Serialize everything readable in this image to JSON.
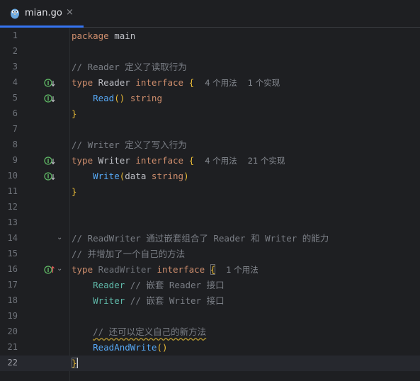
{
  "tab": {
    "title": "mian.go",
    "close": "×"
  },
  "lines": [
    {
      "n": "1"
    },
    {
      "n": "2"
    },
    {
      "n": "3"
    },
    {
      "n": "4"
    },
    {
      "n": "5"
    },
    {
      "n": "6"
    },
    {
      "n": "7"
    },
    {
      "n": "8"
    },
    {
      "n": "9"
    },
    {
      "n": "10"
    },
    {
      "n": "11"
    },
    {
      "n": "12"
    },
    {
      "n": "13"
    },
    {
      "n": "14"
    },
    {
      "n": "15"
    },
    {
      "n": "16"
    },
    {
      "n": "17"
    },
    {
      "n": "18"
    },
    {
      "n": "19"
    },
    {
      "n": "20"
    },
    {
      "n": "21"
    },
    {
      "n": "22"
    }
  ],
  "code": {
    "l1": {
      "kw": "package",
      "name": "main"
    },
    "l3": {
      "comment": "// Reader 定义了读取行为"
    },
    "l4": {
      "kw": "type",
      "name": "Reader",
      "kw2": "interface",
      "brace": "{",
      "hint1": "4 个用法",
      "hint2": "1 个实现"
    },
    "l5": {
      "fn": "Read",
      "parens": "()",
      "type": "string"
    },
    "l6": {
      "brace": "}"
    },
    "l8": {
      "comment": "// Writer 定义了写入行为"
    },
    "l9": {
      "kw": "type",
      "name": "Writer",
      "kw2": "interface",
      "brace": "{",
      "hint1": "4 个用法",
      "hint2": "21 个实现"
    },
    "l10": {
      "fn": "Write",
      "open": "(",
      "param": "data",
      "type": "string",
      "close": ")"
    },
    "l11": {
      "brace": "}"
    },
    "l14": {
      "comment": "// ReadWriter 通过嵌套组合了 Reader 和 Writer 的能力"
    },
    "l15": {
      "comment": "// 并增加了一个自己的方法"
    },
    "l16": {
      "kw": "type",
      "name": "ReadWriter",
      "kw2": "interface",
      "brace": "{",
      "hint1": "1 个用法"
    },
    "l17": {
      "embed": "Reader",
      "comment": "// 嵌套 Reader 接口"
    },
    "l18": {
      "embed": "Writer",
      "comment": "// 嵌套 Writer 接口"
    },
    "l20": {
      "comment": "// 还可以定义自己的新方法"
    },
    "l21": {
      "fn": "ReadAndWrite",
      "parens": "()"
    },
    "l22": {
      "brace": "}"
    }
  },
  "icons": {
    "tab_icon": "gopher-icon",
    "impl_down": "implemented-down-icon",
    "impl_up": "implementing-up-icon",
    "fold": "fold-chevron-icon"
  },
  "colors": {
    "background": "#1e1f22",
    "keyword": "#cf8e6d",
    "function": "#56a8f5",
    "comment": "#7a7e85",
    "brace": "#e8ba36",
    "accent": "#3574f0"
  }
}
